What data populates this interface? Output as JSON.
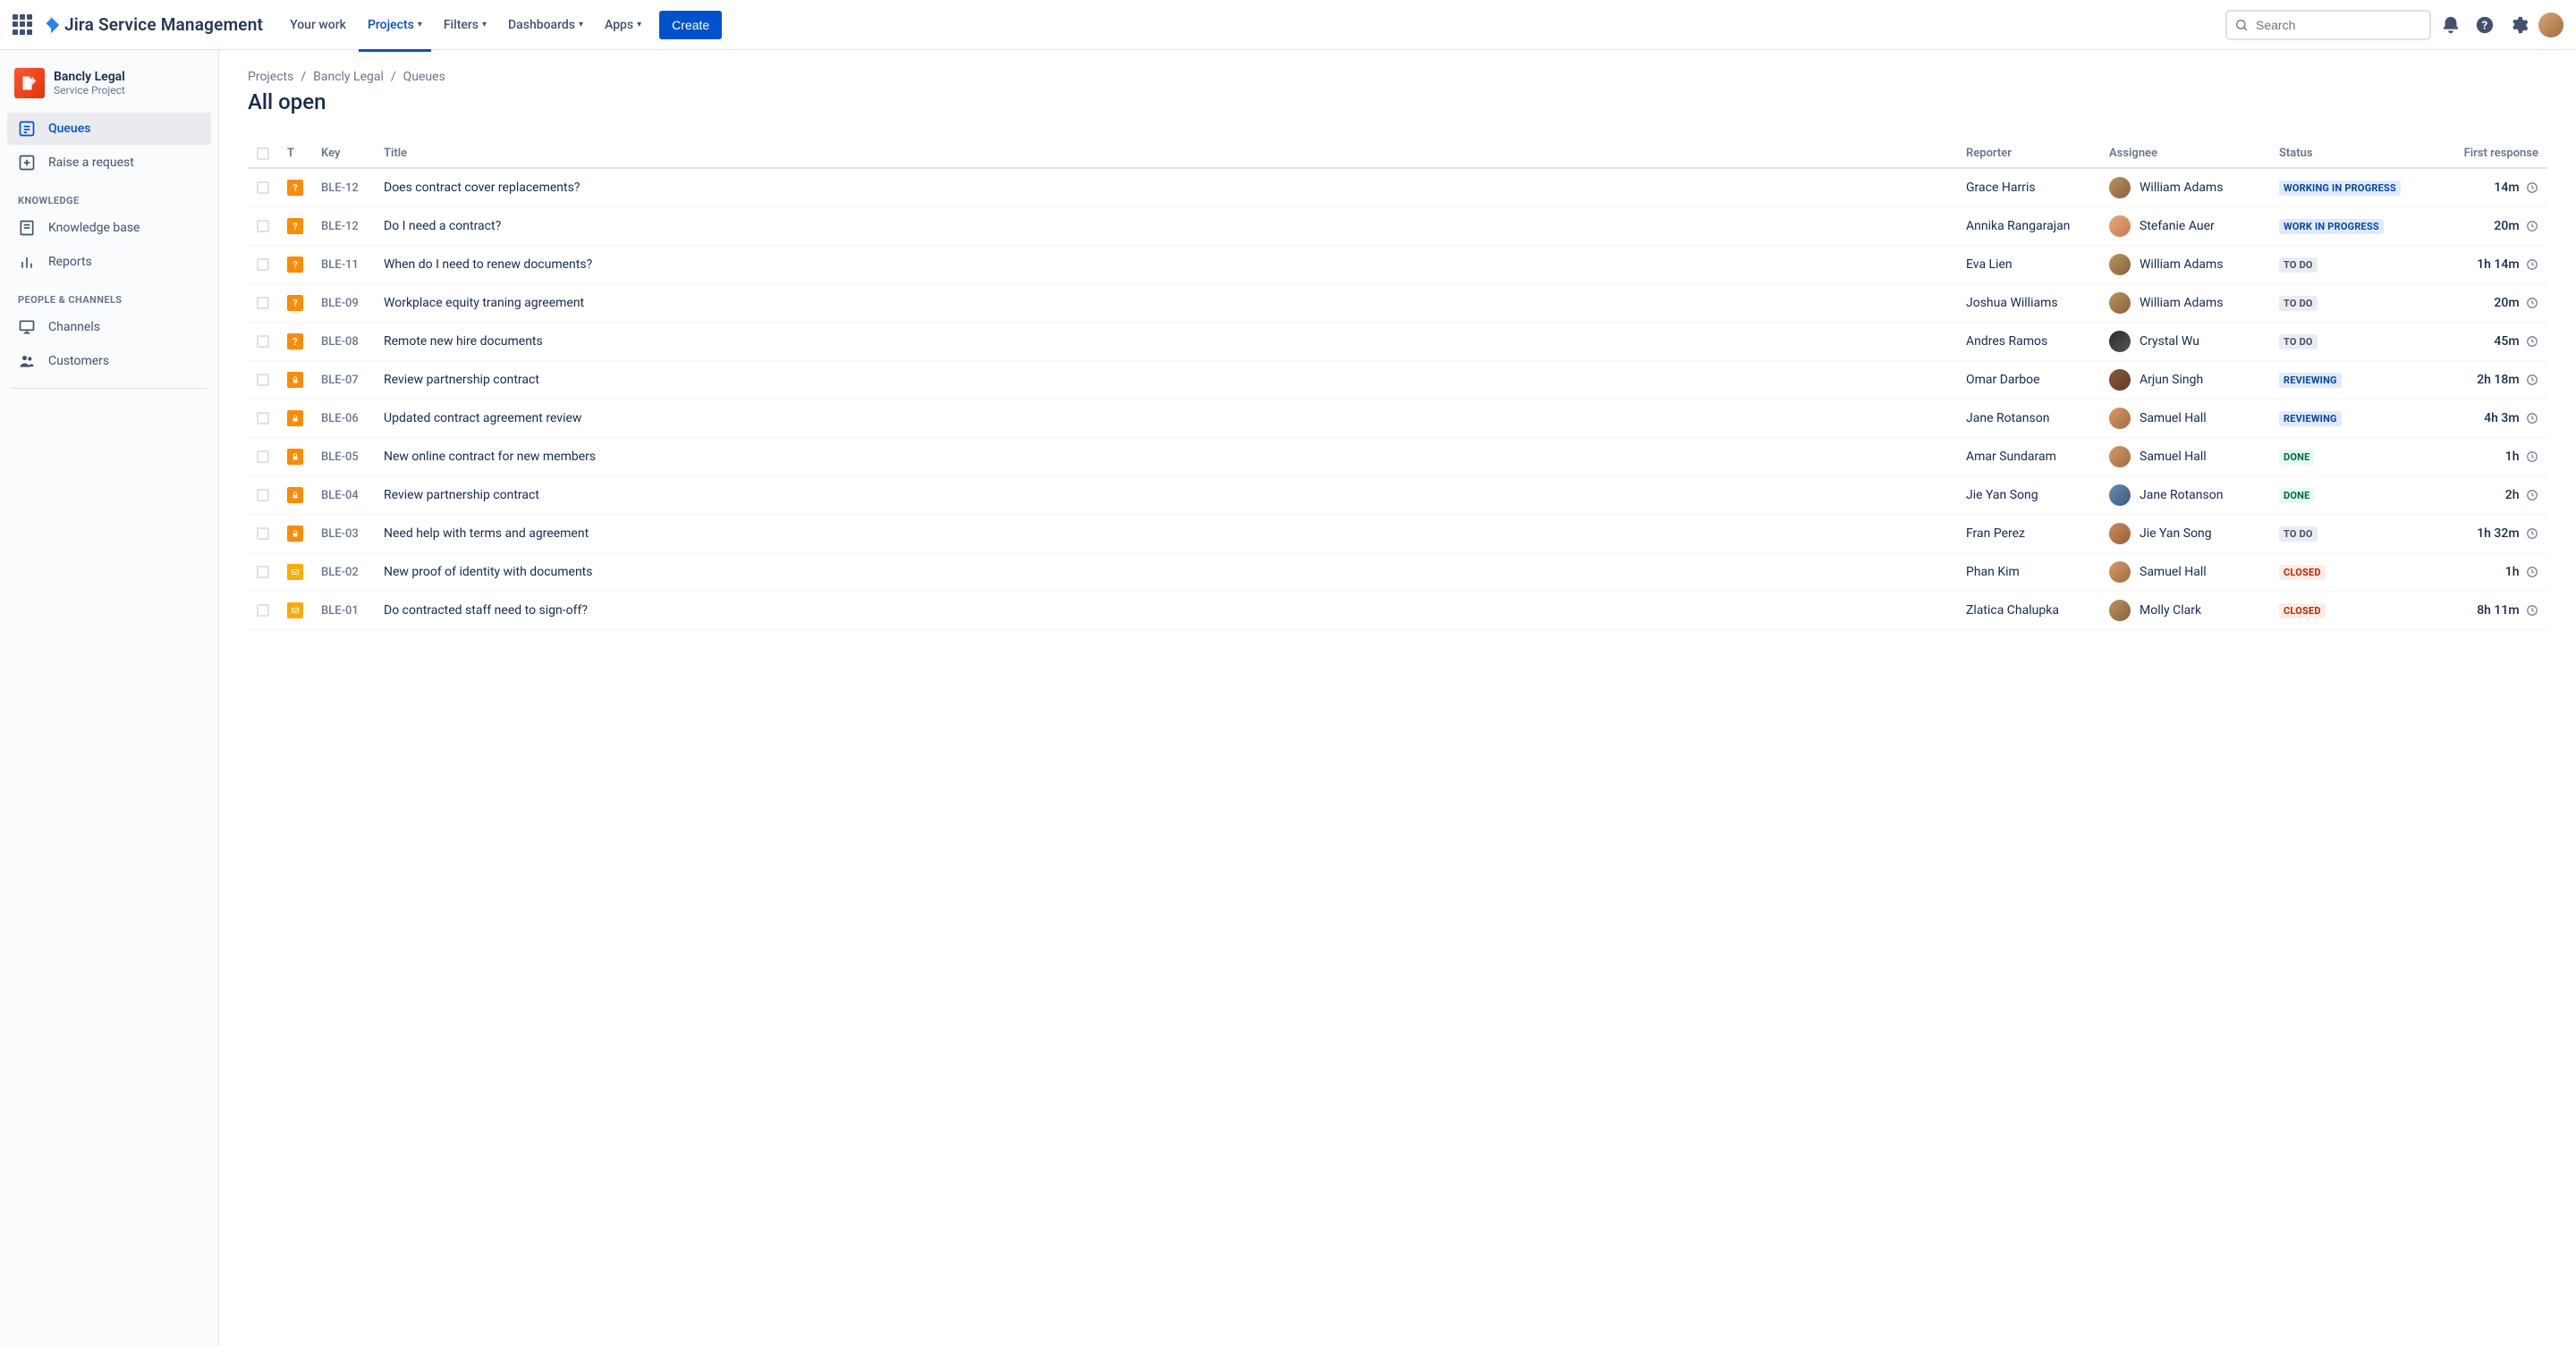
{
  "header": {
    "brand": "Jira Service Management",
    "nav": {
      "your_work": "Your work",
      "projects": "Projects",
      "filters": "Filters",
      "dashboards": "Dashboards",
      "apps": "Apps"
    },
    "create": "Create",
    "search_placeholder": "Search"
  },
  "sidebar": {
    "project_name": "Bancly Legal",
    "project_type": "Service Project",
    "queues": "Queues",
    "raise_request": "Raise a request",
    "heading_knowledge": "KNOWLEDGE",
    "knowledge_base": "Knowledge base",
    "reports": "Reports",
    "heading_people": "PEOPLE & CHANNELS",
    "channels": "Channels",
    "customers": "Customers"
  },
  "breadcrumb": {
    "projects": "Projects",
    "project": "Bancly Legal",
    "queues": "Queues"
  },
  "page_title": "All open",
  "columns": {
    "t": "T",
    "key": "Key",
    "title": "Title",
    "reporter": "Reporter",
    "assignee": "Assignee",
    "status": "Status",
    "first_response": "First response"
  },
  "status_map": {
    "working_in_progress": "WORKING IN PROGRESS",
    "work_in_progress": "WORK IN PROGRESS",
    "to_do": "TO DO",
    "reviewing": "REVIEWING",
    "done": "DONE",
    "closed": "CLOSED"
  },
  "rows": [
    {
      "type": "question",
      "key": "BLE-12",
      "title": "Does contract cover replacements?",
      "reporter": "Grace Harris",
      "assignee": "William Adams",
      "av": "c1",
      "status": "working_in_progress",
      "st_class": "st-blue",
      "fr": "14m"
    },
    {
      "type": "question",
      "key": "BLE-12",
      "title": "Do I need a contract?",
      "reporter": "Annika Rangarajan",
      "assignee": "Stefanie Auer",
      "av": "c2",
      "status": "work_in_progress",
      "st_class": "st-blue",
      "fr": "20m"
    },
    {
      "type": "question",
      "key": "BLE-11",
      "title": "When do I need to renew documents?",
      "reporter": "Eva Lien",
      "assignee": "William Adams",
      "av": "c1",
      "status": "to_do",
      "st_class": "st-grey",
      "fr": "1h 14m"
    },
    {
      "type": "question",
      "key": "BLE-09",
      "title": "Workplace equity traning agreement",
      "reporter": "Joshua Williams",
      "assignee": "William Adams",
      "av": "c1",
      "status": "to_do",
      "st_class": "st-grey",
      "fr": "20m"
    },
    {
      "type": "question",
      "key": "BLE-08",
      "title": "Remote new hire documents",
      "reporter": "Andres Ramos",
      "assignee": "Crystal Wu",
      "av": "c3",
      "status": "to_do",
      "st_class": "st-grey",
      "fr": "45m"
    },
    {
      "type": "lock",
      "key": "BLE-07",
      "title": "Review partnership contract",
      "reporter": "Omar Darboe",
      "assignee": "Arjun Singh",
      "av": "c4",
      "status": "reviewing",
      "st_class": "st-blue",
      "fr": "2h 18m"
    },
    {
      "type": "lock",
      "key": "BLE-06",
      "title": "Updated contract agreement review",
      "reporter": "Jane Rotanson",
      "assignee": "Samuel Hall",
      "av": "c5",
      "status": "reviewing",
      "st_class": "st-blue",
      "fr": "4h 3m"
    },
    {
      "type": "lock",
      "key": "BLE-05",
      "title": "New online contract for new members",
      "reporter": "Amar Sundaram",
      "assignee": "Samuel Hall",
      "av": "c5",
      "status": "done",
      "st_class": "st-green",
      "fr": "1h"
    },
    {
      "type": "lock",
      "key": "BLE-04",
      "title": "Review partnership contract",
      "reporter": "Jie Yan Song",
      "assignee": "Jane Rotanson",
      "av": "c6",
      "status": "done",
      "st_class": "st-green",
      "fr": "2h"
    },
    {
      "type": "lock",
      "key": "BLE-03",
      "title": "Need help with terms and agreement",
      "reporter": "Fran Perez",
      "assignee": "Jie Yan Song",
      "av": "c7",
      "status": "to_do",
      "st_class": "st-grey",
      "fr": "1h 32m"
    },
    {
      "type": "mail",
      "key": "BLE-02",
      "title": "New proof of identity with documents",
      "reporter": "Phan Kim",
      "assignee": "Samuel Hall",
      "av": "c5",
      "status": "closed",
      "st_class": "st-red",
      "fr": "1h"
    },
    {
      "type": "mail",
      "key": "BLE-01",
      "title": "Do contracted staff need to sign-off?",
      "reporter": "Zlatica Chalupka",
      "assignee": "Molly Clark",
      "av": "c1",
      "status": "closed",
      "st_class": "st-red",
      "fr": "8h 11m"
    }
  ]
}
